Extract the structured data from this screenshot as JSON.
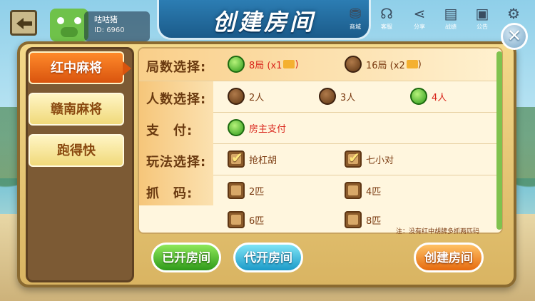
{
  "header": {
    "title": "创建房间",
    "user": {
      "name": "咕咕猪",
      "id": "ID: 6960"
    },
    "icons": [
      {
        "name": "shop-icon",
        "label": "商城",
        "glyph": "⛃"
      },
      {
        "name": "service-icon",
        "label": "客服",
        "glyph": "☊"
      },
      {
        "name": "share-icon",
        "label": "分享",
        "glyph": "⋖"
      },
      {
        "name": "record-icon",
        "label": "战绩",
        "glyph": "▤"
      },
      {
        "name": "notice-icon",
        "label": "公告",
        "glyph": "▣"
      },
      {
        "name": "gear-icon",
        "label": "",
        "glyph": "⚙"
      }
    ],
    "close_glyph": "✕"
  },
  "tabs": [
    {
      "label": "红中麻将",
      "active": true
    },
    {
      "label": "赣南麻将",
      "active": false
    },
    {
      "label": "跑得快",
      "active": false
    }
  ],
  "rows": {
    "rounds": {
      "label": "局数选择:",
      "options": [
        {
          "label": "8局 (x1",
          "selected": true
        },
        {
          "label": "16局 (x2",
          "selected": false
        }
      ]
    },
    "players": {
      "label": "人数选择:",
      "options": [
        {
          "label": "2人",
          "selected": false
        },
        {
          "label": "3人",
          "selected": false
        },
        {
          "label": "4人",
          "selected": true
        }
      ]
    },
    "pay": {
      "label": "支　付:",
      "options": [
        {
          "label": "房主支付",
          "selected": true
        }
      ]
    },
    "rules": {
      "label": "玩法选择:",
      "options": [
        {
          "label": "抢杠胡",
          "checked": true
        },
        {
          "label": "七小对",
          "checked": true
        }
      ]
    },
    "catch": {
      "label": "抓　码:",
      "options": [
        {
          "label": "2匹",
          "checked": false
        },
        {
          "label": "4匹",
          "checked": false
        },
        {
          "label": "6匹",
          "checked": false
        },
        {
          "label": "8匹",
          "checked": false
        }
      ]
    }
  },
  "note": "注：没有红中胡牌多抓两匹码",
  "buttons": {
    "opened": "已开房间",
    "proxy": "代开房间",
    "create": "创建房间"
  }
}
